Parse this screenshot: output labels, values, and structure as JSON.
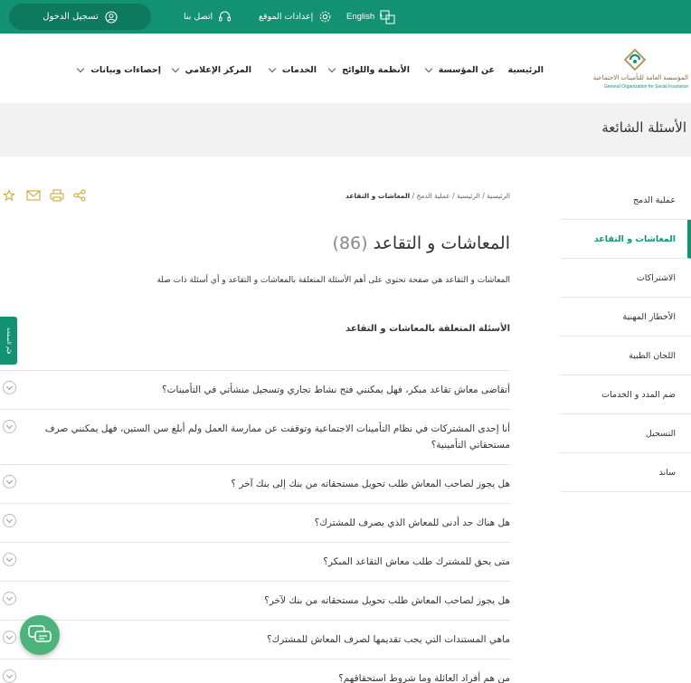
{
  "topbar": {
    "login_label": "تسجيل الدخول",
    "contact_label": "اتصل بنا",
    "settings_label": "إعدادات الموقع",
    "language_label": "English"
  },
  "logo": {
    "arabic_text": "المؤسسة العامة للتأمينات الاجتماعية",
    "english_text": "General Organization for Social Insurance"
  },
  "nav": {
    "home": "الرئيسية",
    "about": "عن المؤسسة",
    "regulations": "الأنظمة واللوائح",
    "services": "الخدمات",
    "media": "المركز الإعلامي",
    "stats": "إحصاءات وبيانات"
  },
  "page_title": "الأسئلة الشائعة",
  "breadcrumb": {
    "home": "الرئيسية",
    "faq": "الرئيسية",
    "merge": "عملية الدمج",
    "current": "المعاشات و التقاعد",
    "separator": "/"
  },
  "sidebar": {
    "items": [
      {
        "label": "عملية الدمج"
      },
      {
        "label": "المعاشات و التقاعد"
      },
      {
        "label": "الاشتراكات"
      },
      {
        "label": "الأخطار المهنية"
      },
      {
        "label": "اللجان الطبية"
      },
      {
        "label": "ضم المدد و الخدمات"
      },
      {
        "label": "التسجيل"
      },
      {
        "label": "ساند"
      }
    ]
  },
  "main": {
    "title": "المعاشات و التقاعد",
    "count": "(86)",
    "description": "المعاشات و التقاعد هي صفحة تحتوي على أهم الأسئلة المتعلقة بالمعاشات و التقاعد و أي أسئلة ذات صلة",
    "subheading": "الأسئلة المتعلقة بالمعاشات و التقاعد"
  },
  "faq": [
    {
      "q": "أتقاضى معاش تقاعد مبكر، فهل يمكنني فتح نشاط تجاري وتسجيل منشأتي في التأمينات؟"
    },
    {
      "q": "أنا إحدى المشتركات في نظام التأمينات الاجتماعية وتوقفت عن ممارسة العمل ولم أبلغ سن الستين، فهل يمكنني صرف مستحقاتي التأمينية؟"
    },
    {
      "q": "هل يجوز لصاحب المعاش طلب تحويل مستحقاته من بنك إلى بنك آخر ؟"
    },
    {
      "q": "هل هناك حد أدنى للمعاش الذي يصرف للمشترك؟"
    },
    {
      "q": "متى يحق للمشترك طلب معاش التقاعد المبكر؟"
    },
    {
      "q": "هل يجوز لصاحب المعاش طلب تحويل مستحقاته من بنك لآخر؟"
    },
    {
      "q": "ماهي المستندات التي يجب تقديمها لصرف المعاش للمشترك؟"
    },
    {
      "q": "من هم أفراد العائلة وما شروط استحقاقهم؟"
    }
  ],
  "feedback_label": "قيّم الصفحة",
  "colors": {
    "brand": "#129271",
    "brand_dark": "#0d7a5d",
    "band": "#f2f2f2"
  }
}
